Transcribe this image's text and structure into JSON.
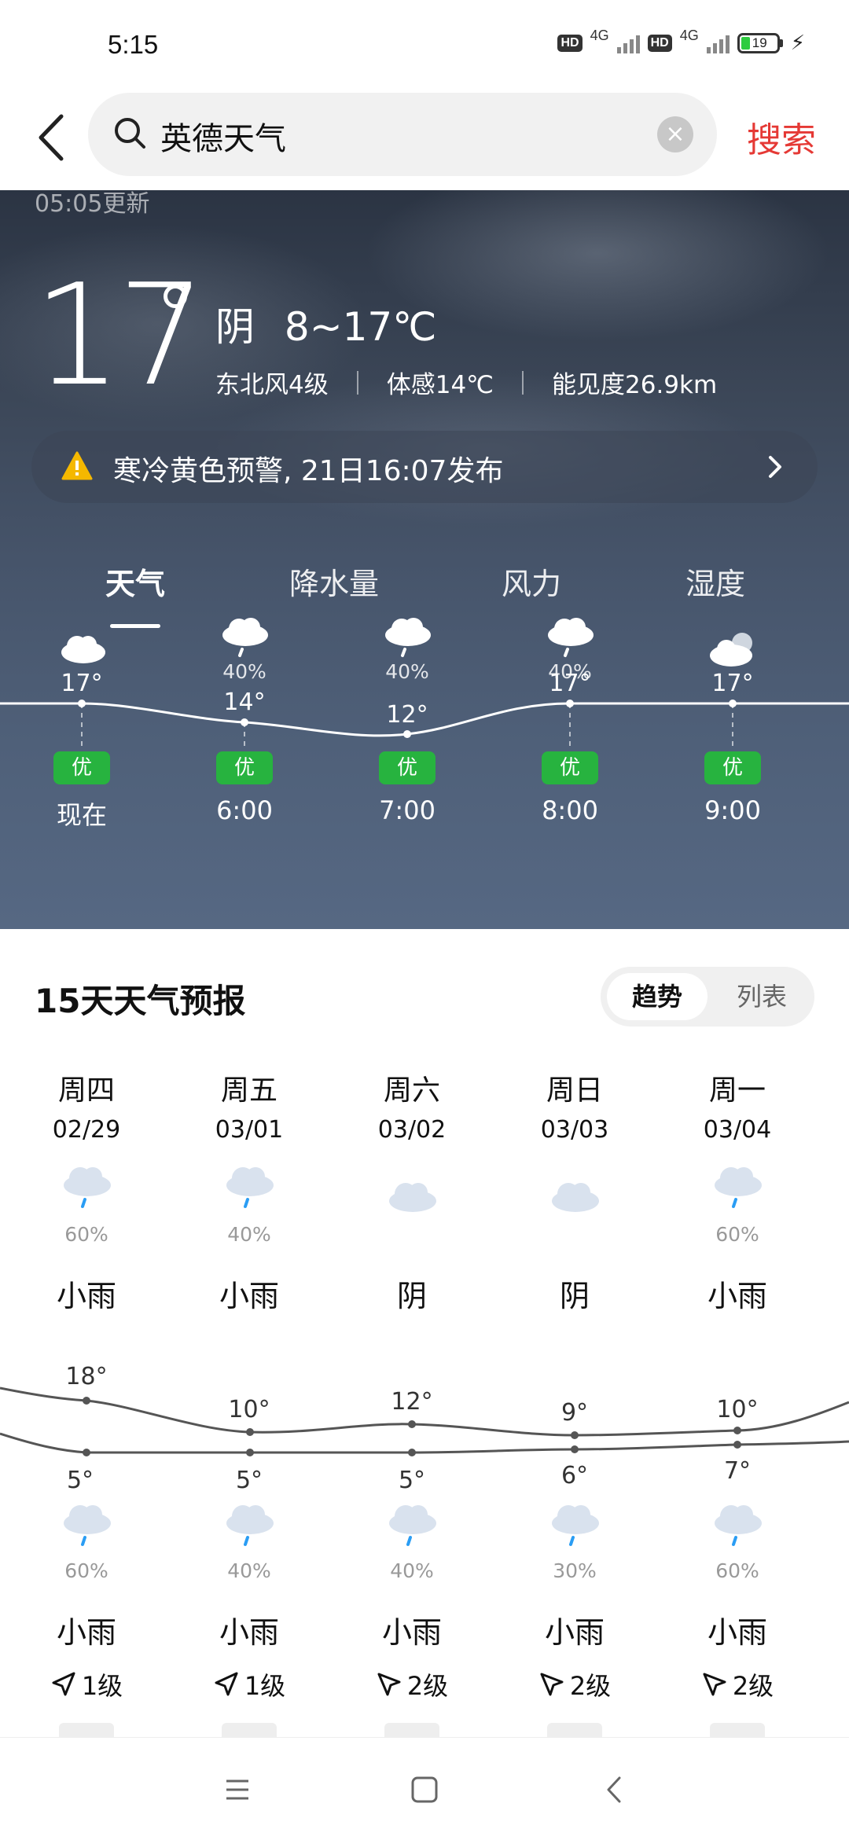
{
  "status_bar": {
    "time": "5:15",
    "hd1": "HD",
    "net1": "4G",
    "hd2": "HD",
    "net2": "4G",
    "battery": "19"
  },
  "search": {
    "query": "英德天气",
    "button": "搜索"
  },
  "current": {
    "update_time": "05:05更新",
    "temp": "17",
    "condition": "阴",
    "range": "8~17℃",
    "wind": "东北风4级",
    "feels_like": "体感14℃",
    "visibility": "能见度26.9km"
  },
  "alert": {
    "text": "寒冷黄色预警, 21日16:07发布",
    "color": "#f5b800"
  },
  "tabs": [
    "天气",
    "降水量",
    "风力",
    "湿度"
  ],
  "hourly": [
    {
      "time": "现在",
      "temp": "17°",
      "precip": "",
      "aqi": "优",
      "icon": "cloud-icon"
    },
    {
      "time": "6:00",
      "temp": "14°",
      "precip": "40%",
      "aqi": "优",
      "icon": "rain-cloud-icon"
    },
    {
      "time": "7:00",
      "temp": "12°",
      "precip": "40%",
      "aqi": "优",
      "icon": "rain-cloud-icon"
    },
    {
      "time": "8:00",
      "temp": "17°",
      "precip": "40%",
      "aqi": "优",
      "icon": "rain-cloud-icon"
    },
    {
      "time": "9:00",
      "temp": "17°",
      "precip": "",
      "aqi": "优",
      "icon": "cloudy-moon-icon"
    }
  ],
  "forecast": {
    "title": "15天天气预报",
    "toggle_on": "趋势",
    "toggle_off": "列表",
    "days": [
      {
        "week": "周四",
        "date": "02/29",
        "day_pct": "60%",
        "day_cond": "小雨",
        "high": "18°",
        "low": "5°",
        "night_pct": "60%",
        "night_cond": "小雨",
        "wind": "1级"
      },
      {
        "week": "周五",
        "date": "03/01",
        "day_pct": "40%",
        "day_cond": "小雨",
        "high": "10°",
        "low": "5°",
        "night_pct": "40%",
        "night_cond": "小雨",
        "wind": "1级"
      },
      {
        "week": "周六",
        "date": "03/02",
        "day_pct": "",
        "day_cond": "阴",
        "high": "12°",
        "low": "5°",
        "night_pct": "40%",
        "night_cond": "小雨",
        "wind": "2级"
      },
      {
        "week": "周日",
        "date": "03/03",
        "day_pct": "",
        "day_cond": "阴",
        "high": "9°",
        "low": "6°",
        "night_pct": "30%",
        "night_cond": "小雨",
        "wind": "2级"
      },
      {
        "week": "周一",
        "date": "03/04",
        "day_pct": "60%",
        "day_cond": "小雨",
        "high": "10°",
        "low": "7°",
        "night_pct": "60%",
        "night_cond": "小雨",
        "wind": "2级"
      }
    ]
  },
  "colors": {
    "accent": "#e53935",
    "aqi_good": "#27b33f"
  }
}
